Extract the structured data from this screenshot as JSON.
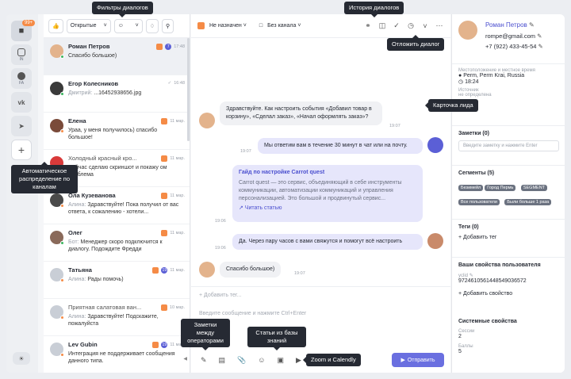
{
  "tooltips": {
    "filters": "Фильтры диалогов",
    "history": "История диалогов",
    "postpone": "Отложить диалог",
    "lead_card": "Карточка лида",
    "auto": "Автоматическое распределение по каналам",
    "notes": "Заметки между операторами",
    "articles": "Статьи из базы знаний",
    "zoom": "Zoom и Calendly"
  },
  "rail": {
    "badge": "99+",
    "instagram": "IN",
    "facebook": "FA"
  },
  "list": {
    "filter_label": "Открытые",
    "items": [
      {
        "name": "Роман Петров",
        "text": "Спасибо большое)",
        "time": "17:48",
        "count": "7"
      },
      {
        "name": "Егор Колесников",
        "who": "Дмитрий:",
        "text": "...16452938656.jpg",
        "time": "16:48"
      },
      {
        "name": "Елена",
        "text": "Ураа, у меня получилось) спасибо большое!",
        "time": "11 мар."
      },
      {
        "name": "Холодный красный кро...",
        "text": "Сейчас сделаю скриншот и покажу ом проблема",
        "time": "11 мар."
      },
      {
        "name": "Ола Кузеванова",
        "who": "Алина:",
        "text": "Здравствуйте! Пока получил от вас ответа, к сожалению - хотели...",
        "time": "11 мар."
      },
      {
        "name": "Олег",
        "who": "Бот:",
        "text": "Менеджер скоро подключится к диалогу. Подождите Фредди",
        "time": "11 мар."
      },
      {
        "name": "Татьяна",
        "who": "Алина:",
        "text": "Рады помочь)",
        "time": "11 мар.",
        "count": "19"
      },
      {
        "name": "Приятная салатовая ван...",
        "who": "Алина:",
        "text": "Здравствуйте! Подскажите, пожалуйста",
        "time": "10 мар."
      },
      {
        "name": "Lev Gubin",
        "text": "Интеграция не поддерживает сообщения данного типа.",
        "time": "11 мар.",
        "count": "19"
      }
    ]
  },
  "chat": {
    "assignee": "Не назначен",
    "channel": "Без канала",
    "m1": "Здравствуйте. Как настроить события «Добавил товар в корзину», «Сделал заказ», «Начал оформлять заказ»?",
    "m1_time": "19:07",
    "m2": "Мы ответим вам в течение 30 минут в чат или на почту.",
    "m2_time": "19:07",
    "article_title": "Гайд по настройке Carrot quest",
    "article_text": "Carrot quest — это сервис, объединяющий в себе инструменты коммуникации, автоматизации коммуникаций и управления персонализацией. Это большой и продвинутый сервис...",
    "article_link": "Читать статью",
    "m3_time": "19:06",
    "m4": "Да. Через пару часов с вами свяжутся и помогут всё настроить",
    "m4_time": "19:06",
    "m5": "Спасибо большое)",
    "m5_time": "19:07",
    "add_tag": "+ Добавить тег...",
    "placeholder": "Введите сообщение и нажмите Ctrl+Enter",
    "send": "Отправить"
  },
  "side": {
    "name": "Роман Петров",
    "email": "rompe@gmail.com",
    "phone": "+7 (922) 433-45-54",
    "location_label": "Местоположение и местное время",
    "location": "Perm, Perm Krai, Russia",
    "local_time": "18:24",
    "source_label": "Источник",
    "source_value": "не определена",
    "notes_title": "Заметки (0)",
    "notes_placeholder": "Введите заметку и нажмите Enter",
    "segments_title": "Сегменты (5)",
    "segments": [
      "Безимейл",
      "Город Пермь",
      "SEGMENT",
      "Все пользователи",
      "Были больше 1 раза"
    ],
    "tags_title": "Теги (0)",
    "add_tag": "+ Добавить тег",
    "props_title": "Ваши свойства пользователя",
    "yclid_label": "yclid",
    "yclid_value": "9724610561448549036572",
    "add_prop": "+ Добавить свойство",
    "sys_title": "Системные свойства",
    "sessions_label": "Сессии",
    "sessions_value": "2",
    "score_label": "Баллы",
    "score_value": "5"
  }
}
